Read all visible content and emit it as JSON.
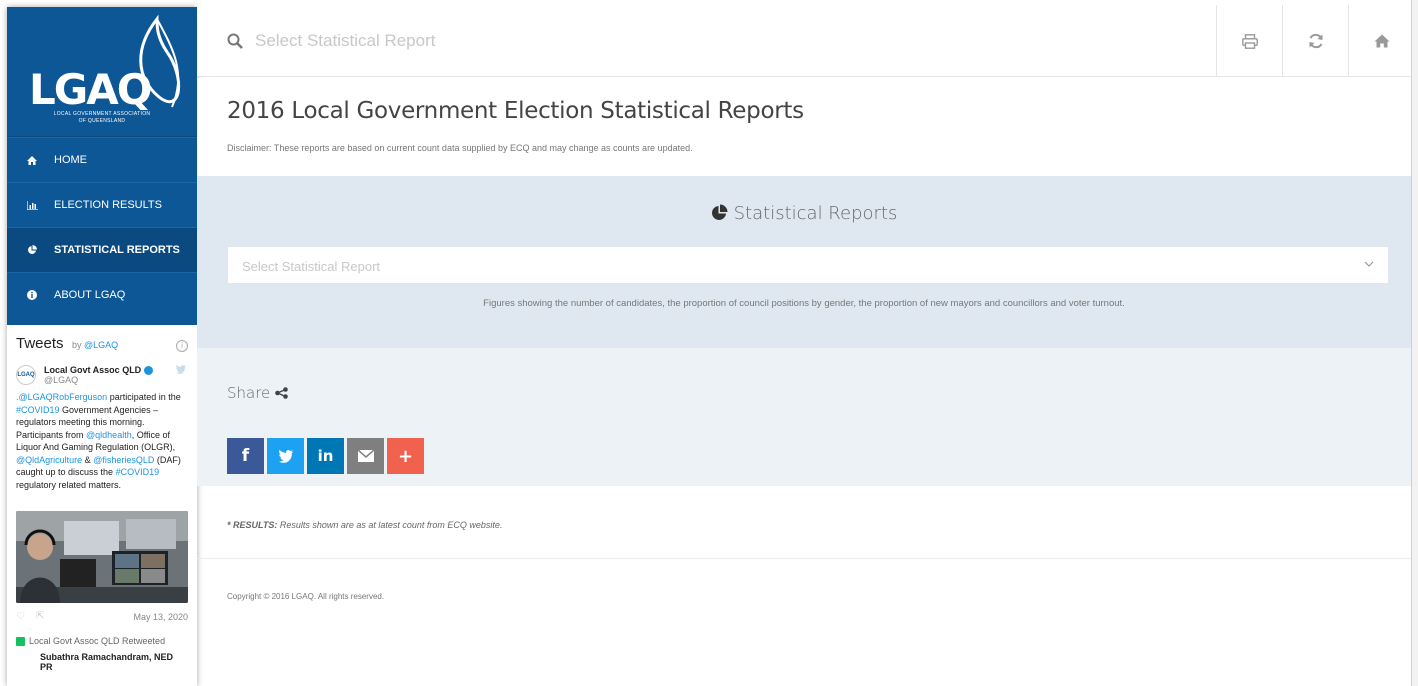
{
  "brand": {
    "logo_text": "LGAQ",
    "logo_sub_line1": "LOCAL GOVERNMENT ASSOCIATION",
    "logo_sub_line2": "OF QUEENSLAND",
    "primary_color": "#0d5796",
    "active_color": "#0a4a80"
  },
  "sidebar": {
    "items": [
      {
        "label": "HOME",
        "icon": "home-icon",
        "active": false
      },
      {
        "label": "ELECTION RESULTS",
        "icon": "bar-chart-icon",
        "active": false
      },
      {
        "label": "STATISTICAL REPORTS",
        "icon": "pie-chart-icon",
        "active": true
      },
      {
        "label": "ABOUT LGAQ",
        "icon": "info-icon",
        "active": false
      }
    ]
  },
  "tweets": {
    "title": "Tweets",
    "by": "by",
    "handle_link": "@LGAQ",
    "author_name": "Local Govt Assoc QLD",
    "author_handle": "@LGAQ",
    "avatar_text": "LGAQ",
    "body_parts": [
      {
        "text": ".@LGAQRobFerguson",
        "link": true
      },
      {
        "text": " participated in the ",
        "link": false
      },
      {
        "text": "#COVID19",
        "link": true
      },
      {
        "text": " Government Agencies – regulators meeting this morning. Participants from ",
        "link": false
      },
      {
        "text": "@qldhealth",
        "link": true
      },
      {
        "text": ", Office of Liquor And Gaming Regulation (OLGR), ",
        "link": false
      },
      {
        "text": "@QldAgriculture",
        "link": true
      },
      {
        "text": "  & ",
        "link": false
      },
      {
        "text": "@fisheriesQLD",
        "link": true
      },
      {
        "text": " (DAF) caught up to discuss the ",
        "link": false
      },
      {
        "text": "#COVID19",
        "link": true
      },
      {
        "text": " regulatory related matters.",
        "link": false
      }
    ],
    "date": "May 13, 2020",
    "retweet_label": "Local Govt Assoc QLD Retweeted",
    "next_author": "Subathra Ramachandram, NED PR"
  },
  "topbar": {
    "search_placeholder": "Select Statistical Report",
    "buttons": [
      "print-icon",
      "refresh-icon",
      "home-icon"
    ]
  },
  "header": {
    "title": "2016 Local Government Election Statistical Reports",
    "disclaimer": "Disclaimer: These reports are based on current count data supplied by ECQ and may change as counts are updated."
  },
  "reports": {
    "title": "Statistical Reports",
    "select_placeholder": "Select Statistical Report",
    "description": "Figures showing the number of candidates, the proportion of council positions by gender, the proportion of new mayors and councillors and voter turnout."
  },
  "share": {
    "label": "Share",
    "buttons": [
      {
        "name": "facebook",
        "glyph": "f",
        "color": "#3b5998"
      },
      {
        "name": "twitter",
        "glyph": "t",
        "color": "#1da1f2"
      },
      {
        "name": "linkedin",
        "glyph": "in",
        "color": "#0077b5"
      },
      {
        "name": "email",
        "glyph": "✉",
        "color": "#7f7f7f"
      },
      {
        "name": "more",
        "glyph": "+",
        "color": "#f0624d"
      }
    ]
  },
  "footer": {
    "results_bold": "* RESULTS:",
    "results_text": " Results shown are as at latest count from ECQ website.",
    "copyright": "Copyright © 2016 LGAQ. All rights reserved."
  }
}
